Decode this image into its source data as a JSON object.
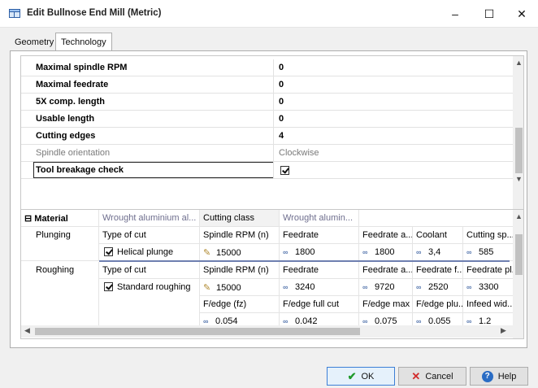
{
  "window": {
    "title": "Edit Bullnose End Mill (Metric)",
    "controls": {
      "minimize": "–",
      "maximize": "☐",
      "close": "✕"
    }
  },
  "tabs": [
    {
      "label": "Geometry",
      "active": false
    },
    {
      "label": "Technology",
      "active": true
    }
  ],
  "properties": [
    {
      "name": "Maximal spindle RPM",
      "value": "0",
      "disabled": false,
      "checkbox": false
    },
    {
      "name": "Maximal feedrate",
      "value": "0",
      "disabled": false,
      "checkbox": false
    },
    {
      "name": "5X comp. length",
      "value": "0",
      "disabled": false,
      "checkbox": false
    },
    {
      "name": "Usable length",
      "value": "0",
      "disabled": false,
      "checkbox": false
    },
    {
      "name": "Cutting edges",
      "value": "4",
      "disabled": false,
      "checkbox": false
    },
    {
      "name": "Spindle orientation",
      "value": "Clockwise",
      "disabled": true,
      "checkbox": false
    },
    {
      "name": "Tool breakage check",
      "value": "",
      "disabled": false,
      "checkbox": true,
      "checked": true,
      "focused": true
    }
  ],
  "grid": {
    "material": {
      "label": "Material",
      "expander": "⊟",
      "material_value": "Wrought aluminium al...",
      "cutting_class_label": "Cutting class",
      "cutting_class_value": "Wrought alumin..."
    },
    "plunging": {
      "label": "Plunging",
      "type_of_cut_label": "Type of cut",
      "type_of_cut_value": "Helical plunge",
      "headers": [
        "Spindle RPM (n)",
        "Feedrate",
        "Feedrate a...",
        "Coolant",
        "Cutting sp..."
      ],
      "values": [
        "15000",
        "1800",
        "1800",
        "3,4",
        "585"
      ]
    },
    "roughing": {
      "label": "Roughing",
      "type_of_cut_label": "Type of cut",
      "type_of_cut_value": "Standard roughing",
      "headers": [
        "Spindle RPM (n)",
        "Feedrate",
        "Feedrate a...",
        "Feedrate f...",
        "Feedrate pl..."
      ],
      "values": [
        "15000",
        "3240",
        "9720",
        "2520",
        "3300"
      ],
      "headers2": [
        "F/edge (fz)",
        "F/edge full cut",
        "F/edge max",
        "F/edge plu...",
        "Infeed wid..."
      ],
      "values2": [
        "0.054",
        "0.042",
        "0.075",
        "0.055",
        "1.2"
      ]
    }
  },
  "buttons": {
    "ok": "OK",
    "cancel": "Cancel",
    "help": "Help"
  },
  "colors": {
    "accent": "#3c7fd6",
    "row_separator": "#6e7fb0",
    "muted_text": "#6e6e8e"
  }
}
